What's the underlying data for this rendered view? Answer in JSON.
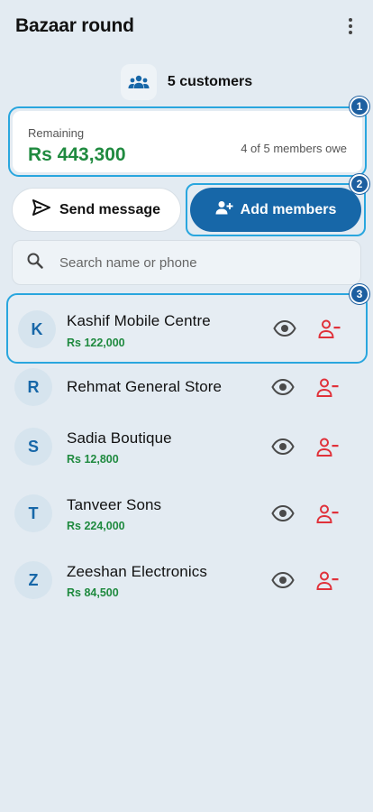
{
  "app": {
    "title": "Bazaar round"
  },
  "group": {
    "label": "5 customers"
  },
  "summary": {
    "remaining_label": "Remaining",
    "remaining_amount": "Rs 443,300",
    "owe_text": "4 of 5 members owe"
  },
  "actions": {
    "send_label": "Send message",
    "add_label": "Add members"
  },
  "search": {
    "placeholder": "Search name or phone"
  },
  "badges": [
    "1",
    "2",
    "3"
  ],
  "members": [
    {
      "initial": "K",
      "name": "Kashif Mobile Centre",
      "amount": "Rs 122,000",
      "selected": true
    },
    {
      "initial": "R",
      "name": "Rehmat General Store",
      "amount": ""
    },
    {
      "initial": "S",
      "name": "Sadia Boutique",
      "amount": "Rs 12,800"
    },
    {
      "initial": "T",
      "name": "Tanveer Sons",
      "amount": "Rs 224,000"
    },
    {
      "initial": "Z",
      "name": "Zeeshan Electronics",
      "amount": "Rs 84,500"
    }
  ],
  "colors": {
    "accent": "#1767a8",
    "highlight": "#29a6de",
    "money": "#1f8a3f",
    "danger": "#e0313a",
    "background": "#e3ebf2"
  },
  "icons": {
    "more": "more-vertical-icon",
    "group": "group-icon",
    "send": "send-icon",
    "add": "add-person-icon",
    "search": "search-icon",
    "view": "eye-icon",
    "remove": "remove-person-icon"
  }
}
